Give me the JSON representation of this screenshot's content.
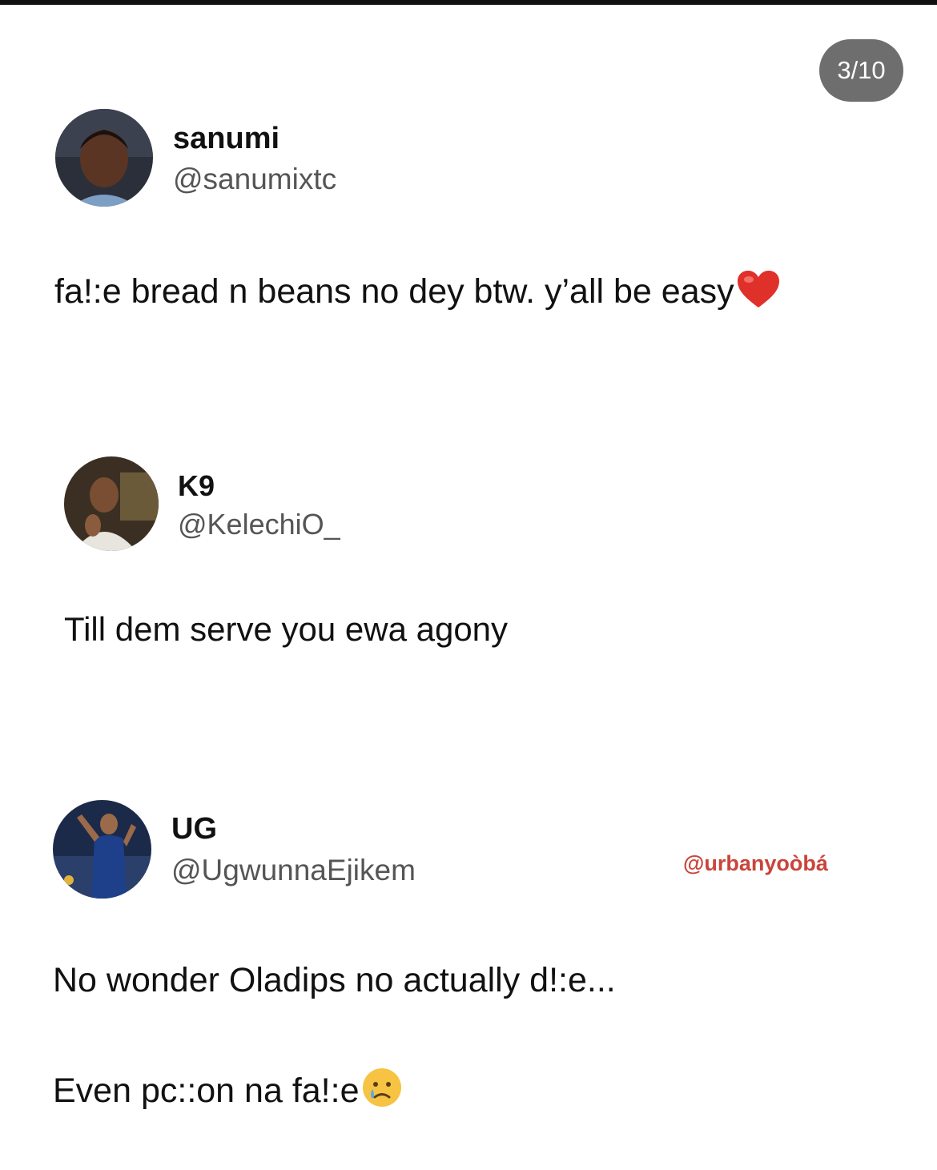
{
  "story_counter": "3/10",
  "watermark": "@urbanyoòbá",
  "posts": [
    {
      "display_name": "sanumi",
      "handle": "@sanumixtc",
      "lines": [
        "fa!:e bread n beans no dey btw. y’all be easy"
      ],
      "emoji": "red-heart-icon"
    },
    {
      "display_name": "K9",
      "handle": "@KelechiO_",
      "lines": [
        "Till dem serve you ewa agony"
      ]
    },
    {
      "display_name": "UG",
      "handle": "@UgwunnaEjikem",
      "lines": [
        "No wonder Oladips no actually d!:e...",
        "Even pc::on na fa!:e"
      ],
      "emoji": "sad-tear-face-icon"
    }
  ],
  "colors": {
    "counter_bg": "#6e6e6e",
    "watermark": "#c9453c",
    "handle": "#555555",
    "text": "#111111"
  }
}
